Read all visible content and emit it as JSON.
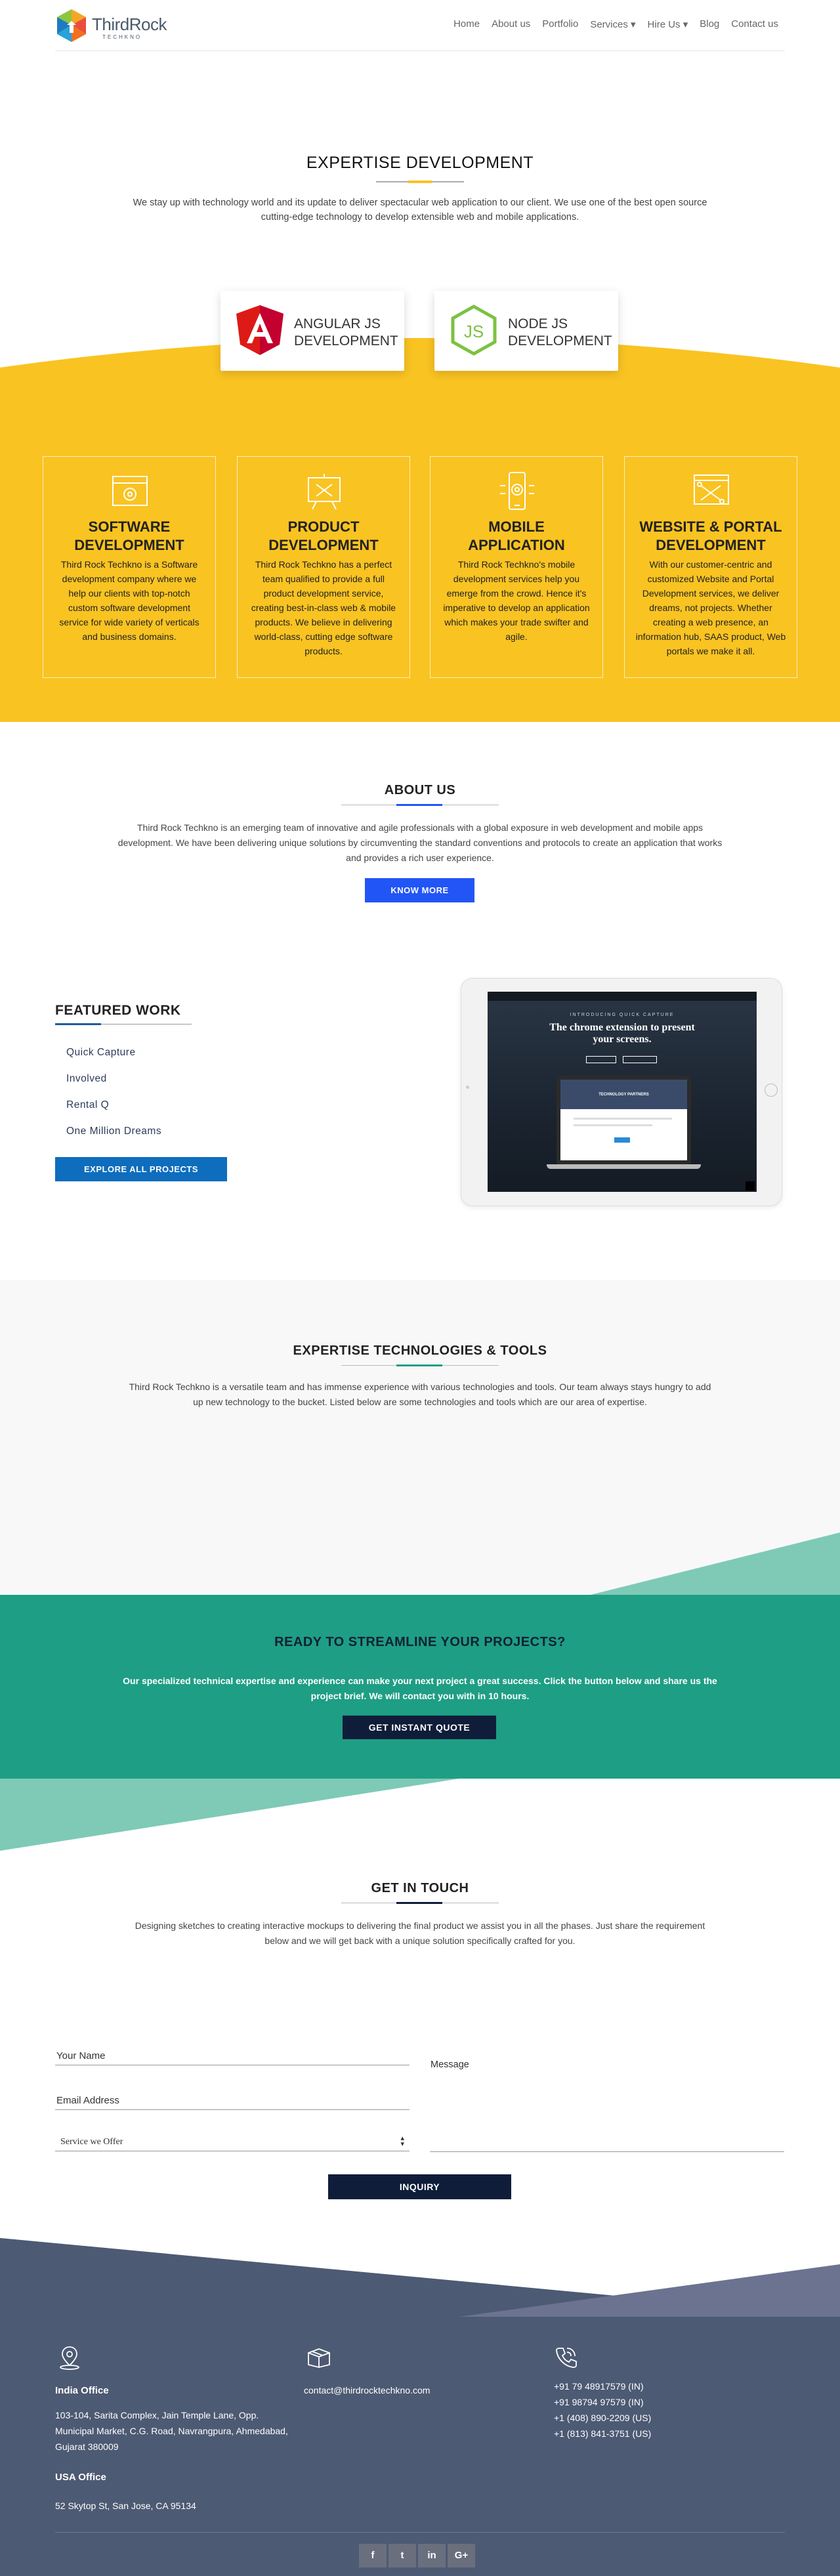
{
  "header": {
    "logo_name": "ThirdRock",
    "logo_sub": "TECHKNO",
    "nav": [
      "Home",
      "About us",
      "Portfolio",
      "Services ▾",
      "Hire Us ▾",
      "Blog",
      "Contact us"
    ]
  },
  "expertise": {
    "title": "EXPERTISE DEVELOPMENT",
    "text": "We stay up with technology world and its update to deliver spectacular web application to our client. We use one of the best open source cutting-edge technology to develop extensible web and mobile applications.",
    "cards": [
      {
        "line1": "ANGULAR JS",
        "line2": "DEVELOPMENT",
        "icon": "angular-icon"
      },
      {
        "line1": "NODE JS",
        "line2": "DEVELOPMENT",
        "icon": "nodejs-icon"
      }
    ]
  },
  "services": [
    {
      "title1": "SOFTWARE",
      "title2": "DEVELOPMENT",
      "icon": "settings-window-icon",
      "desc": "Third Rock Techkno is a Software development company where we help our clients with top-notch custom software development service for wide variety of verticals and business domains."
    },
    {
      "title1": "PRODUCT",
      "title2": "DEVELOPMENT",
      "icon": "presentation-board-icon",
      "desc": "Third Rock Techkno has a perfect team qualified to provide a full product development service, creating best-in-class web & mobile products. We believe in delivering world-class, cutting edge software products."
    },
    {
      "title1": "MOBILE",
      "title2": "APPLICATION",
      "icon": "mobile-gear-icon",
      "desc": "Third Rock Techkno's mobile development services help you emerge from the crowd. Hence it's imperative to develop an application which makes your trade swifter and agile."
    },
    {
      "title1": "WEBSITE & PORTAL",
      "title2": "DEVELOPMENT",
      "icon": "browser-tools-icon",
      "desc": "With our customer-centric and customized Website and Portal Development services, we deliver dreams, not projects. Whether creating a web presence, an information hub, SAAS product, Web portals we make it all."
    }
  ],
  "about": {
    "title": "ABOUT US",
    "text": "Third Rock Techkno is an emerging team of innovative and agile professionals with a global exposure in web development and mobile apps development. We have been delivering unique solutions by circumventing the standard conventions and protocols to create an application that works and provides a rich user experience.",
    "button": "KNOW MORE"
  },
  "featured": {
    "title": "FEATURED WORK",
    "items": [
      "Quick Capture",
      "Involved",
      "Rental Q",
      "One Million Dreams"
    ],
    "button": "EXPLORE ALL PROJECTS",
    "screen_kicker": "INTRODUCING QUICK CAPTURE",
    "screen_headline1": "The chrome extension to present",
    "screen_headline2": "your screens.",
    "screen_sub": "TECHNOLOGY PARTNERS"
  },
  "tools": {
    "title": "EXPERTISE TECHNOLOGIES & TOOLS",
    "text": "Third Rock Techkno is a versatile team and has immense experience with various technologies and tools. Our team always stays hungry to add up new technology to the bucket. Listed below are some technologies and tools which are our area of expertise."
  },
  "cta": {
    "title": "READY TO STREAMLINE YOUR PROJECTS?",
    "text": "Our specialized technical expertise and experience can make your next project a great success. Click the button below and share us the project brief. We will contact you with in 10 hours.",
    "button": "GET INSTANT QUOTE"
  },
  "contact": {
    "title": "GET IN TOUCH",
    "text": "Designing sketches to creating interactive mockups to delivering the final product we assist you in all the phases. Just share the requirement below and we will get back with a unique solution specifically crafted for you.",
    "name_label": "Your Name",
    "email_label": "Email Address",
    "service_label": "Service we Offer",
    "message_label": "Message",
    "button": "INQUIRY"
  },
  "footer": {
    "india_title": "India Office",
    "india_addr": "103-104, Sarita Complex, Jain Temple Lane, Opp. Municipal Market, C.G. Road, Navrangpura, Ahmedabad, Gujarat 380009",
    "usa_title": "USA Office",
    "usa_addr": "52 Skytop St, San Jose, CA 95134",
    "email": "contact@thirdrocktechkno.com",
    "phones": [
      "+91 79 48917579 (IN)",
      "+91 98794 97579 (IN)",
      "+1 (408) 890-2209 (US)",
      "+1 (813) 841-3751 (US)"
    ],
    "social": [
      "f",
      "t",
      "in",
      "G+"
    ]
  },
  "colors": {
    "yellow": "#f9c322",
    "blue": "#2255f5",
    "green": "#1e9e84",
    "navy": "#0f1d3a",
    "footer": "#4d5a73"
  }
}
